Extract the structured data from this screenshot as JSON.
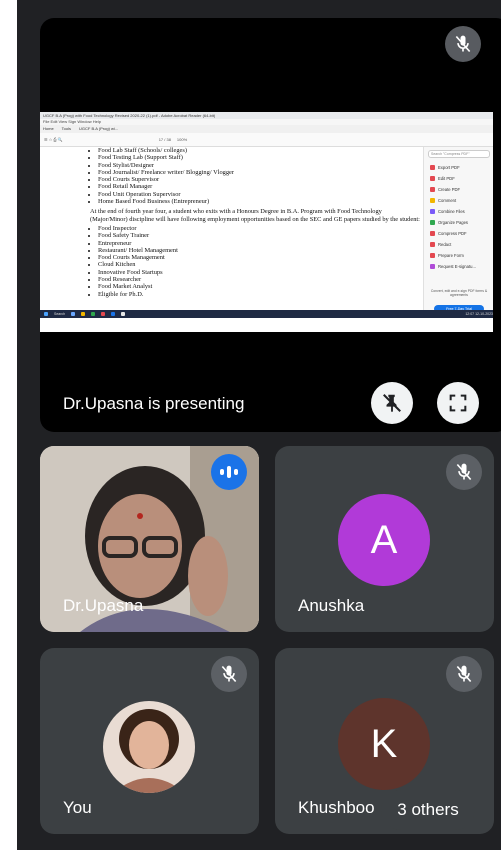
{
  "presentation": {
    "label": "Dr.Upasna is presenting",
    "shared_screen": {
      "window_title": "UGCF B.A (Prog) with Food Technology Revised 2020-22 (1).pdf - Adobe Acrobat Reader (64-bit)",
      "menu": "File  Edit  View  Sign  Window  Help",
      "tabs": [
        "Home",
        "Tools",
        "UGCF B.A (Prog) wi..."
      ],
      "toolbar_page": "17 / 38",
      "toolbar_zoom": "100%",
      "doc_list1": [
        "Food Lab Staff (Schools/ colleges)",
        "Food Testing Lab (Support Staff)",
        "Food Stylist/Designer",
        "Food Journalist/ Freelance writer/ Blogging/ Vlogger",
        "Food Courts Supervisor",
        "Food Retail Manager",
        "Food Unit Operation Supervisor",
        "Home Based Food Business (Entrepreneur)"
      ],
      "doc_paragraph": "At the end of fourth year four, a student who exits with a Honours Degree in B.A. Program with Food Technology (Major/Minor) discipline will have following employment opportunities based on the SEC and GE papers studied by the student:",
      "doc_list2": [
        "Food Inspector",
        "Food Safety Trainer",
        "Entrepreneur",
        "Restaurant/ Hotel Management",
        "Food Courts Management",
        "Cloud Kitchen",
        "Innovative Food Startups",
        "Food Researcher",
        "Food Market Analyst",
        "Eligible for Ph.D."
      ],
      "side_search": "Search \"Compress PDF\"",
      "side_tools": [
        {
          "label": "Export PDF",
          "color": "#e34850"
        },
        {
          "label": "Edit PDF",
          "color": "#e34850"
        },
        {
          "label": "Create PDF",
          "color": "#e34850"
        },
        {
          "label": "Comment",
          "color": "#f2b600"
        },
        {
          "label": "Combine Files",
          "color": "#7a5af8"
        },
        {
          "label": "Organize Pages",
          "color": "#2fa84f"
        },
        {
          "label": "Compress PDF",
          "color": "#e34850"
        },
        {
          "label": "Redact",
          "color": "#e34850"
        },
        {
          "label": "Prepare Form",
          "color": "#e34850"
        },
        {
          "label": "Request E-signatu...",
          "color": "#b04cd8"
        }
      ],
      "side_promo": "Convert, edit and e-sign PDF forms & agreements",
      "side_trial": "Free 7-Day Trial",
      "taskbar_search": "Search",
      "taskbar_clock": "12:07  12-10-2023"
    }
  },
  "participants": [
    {
      "name": "Dr.Upasna",
      "speaking": true
    },
    {
      "name": "Anushka",
      "initial": "A",
      "avatar_color": "#b13ad8",
      "muted": true
    },
    {
      "name": "You",
      "muted": true
    },
    {
      "name": "Khushboo",
      "initial": "K",
      "avatar_color": "#5e342c",
      "muted": true
    }
  ],
  "others": {
    "label": "3 others"
  },
  "icons": {
    "muted": "mic-off-icon",
    "unpin": "pin-off-icon",
    "fullscreen": "fullscreen-icon",
    "speaking": "speaking-indicator-icon"
  }
}
